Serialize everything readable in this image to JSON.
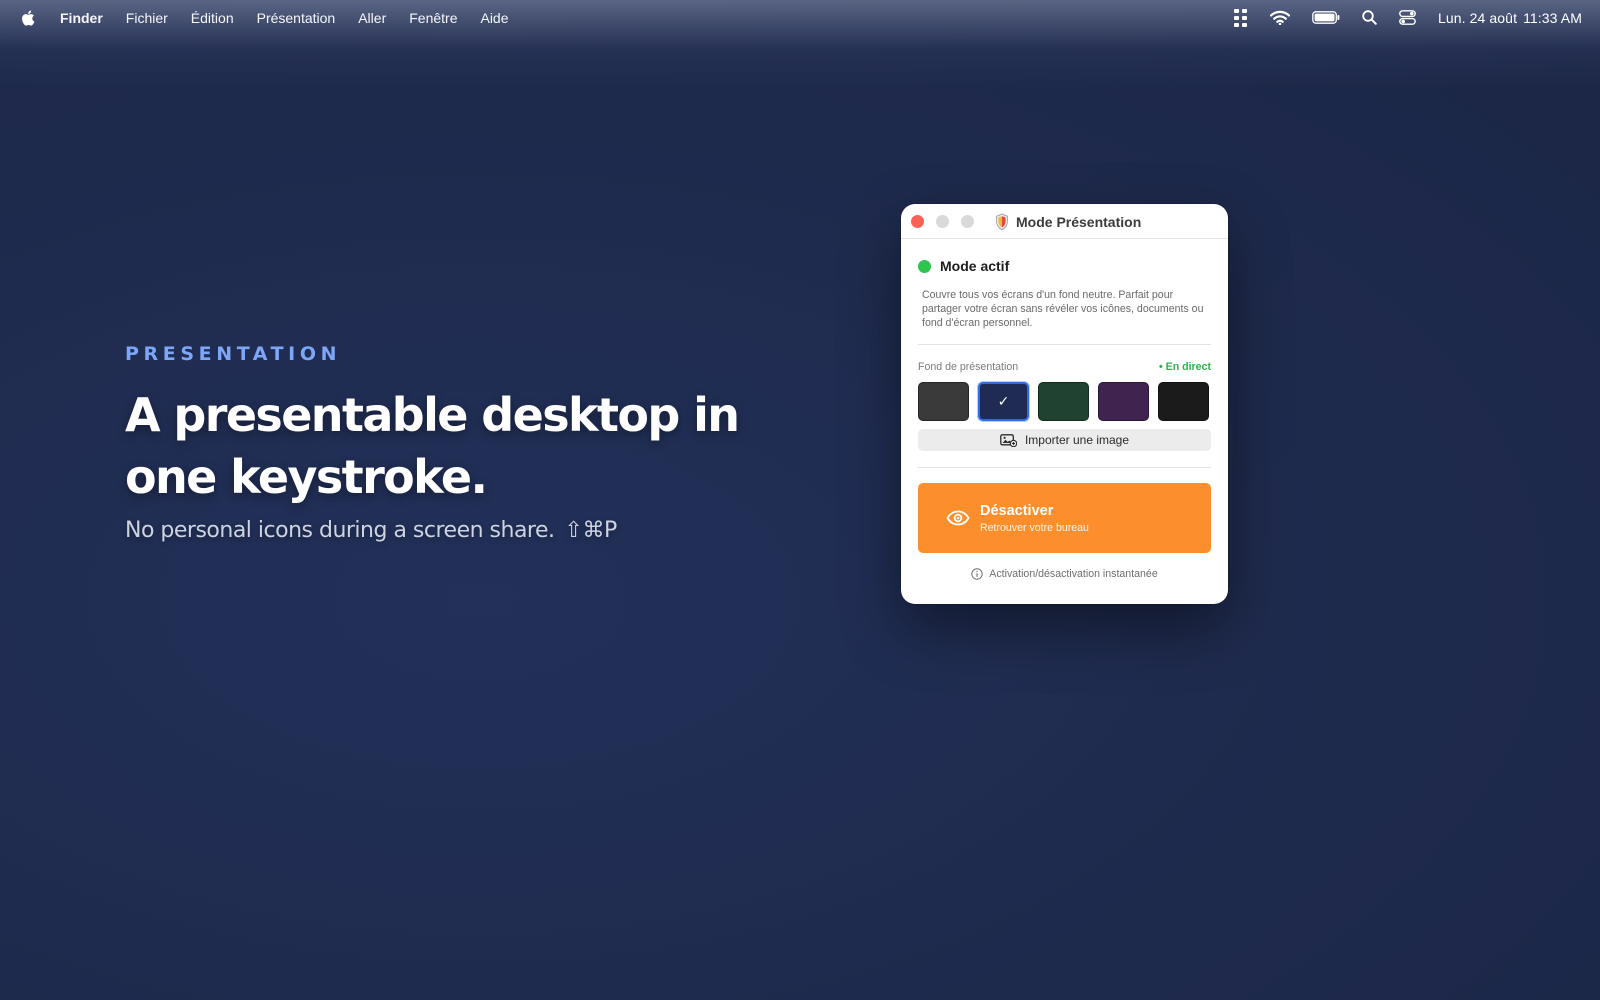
{
  "menubar": {
    "apple_icon": "apple-logo-icon",
    "app_name": "Finder",
    "items": [
      "Fichier",
      "Édition",
      "Présentation",
      "Aller",
      "Fenêtre",
      "Aide"
    ],
    "status_icons": [
      "apps-grid-icon",
      "wifi-icon",
      "battery-icon",
      "search-icon",
      "control-center-icon"
    ],
    "date": "Lun. 24 août",
    "time": "11:33 AM"
  },
  "hero": {
    "eyebrow": "PRESENTATION",
    "headline": "A presentable desktop in one keystroke.",
    "subline": "No personal icons during a screen share.",
    "shortcut": "⇧⌘P",
    "eyebrow_color": "#7ea6f6"
  },
  "window": {
    "title": "Mode Présentation",
    "status_label": "Mode actif",
    "status_color": "#2fc450",
    "description": "Couvre tous vos écrans d'un fond neutre. Parfait pour partager votre écran sans révéler vos icônes, documents ou fond d'écran personnel.",
    "background_label": "Fond de présentation",
    "live_badge": "• En direct",
    "swatches": [
      {
        "name": "graphite",
        "color": "#3a3a3a",
        "selected": false
      },
      {
        "name": "navy",
        "color": "#1f2b52",
        "selected": true
      },
      {
        "name": "forest",
        "color": "#1f4330",
        "selected": false
      },
      {
        "name": "plum",
        "color": "#40244f",
        "selected": false
      },
      {
        "name": "black",
        "color": "#1b1b1b",
        "selected": false
      }
    ],
    "selected_mark": "✓",
    "import_label": "Importer une image",
    "deactivate_title": "Désactiver",
    "deactivate_subtitle": "Retrouver votre bureau",
    "deactivate_color": "#fc8f2b",
    "footer_text": "Activation/désactivation instantanée"
  }
}
